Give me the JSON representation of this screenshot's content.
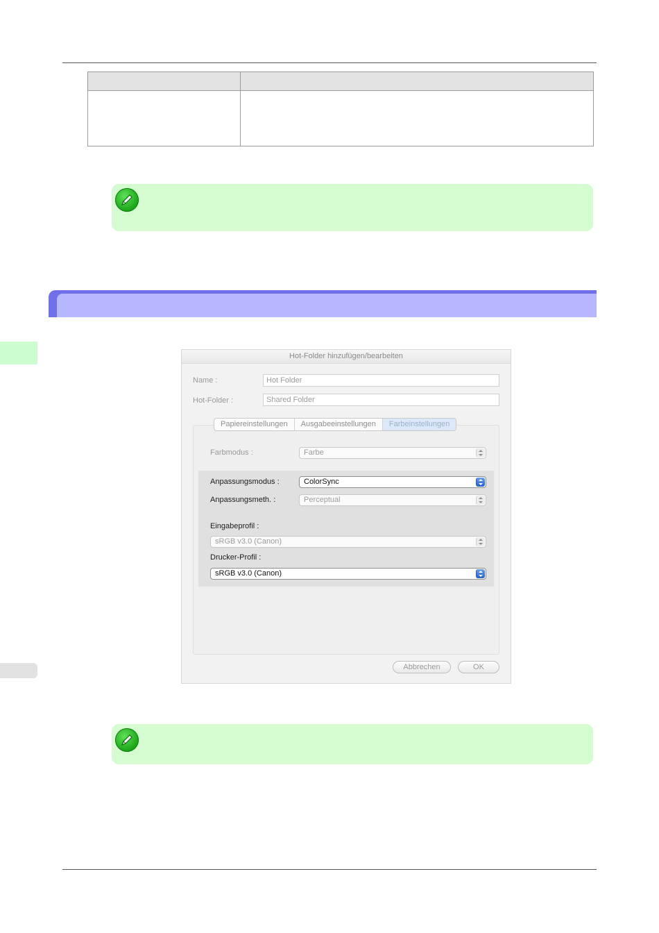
{
  "dialog": {
    "title": "Hot-Folder hinzufügen/bearbeiten",
    "name_label": "Name :",
    "name_value": "Hot Folder",
    "hotfolder_label": "Hot-Folder :",
    "hotfolder_value": "Shared Folder",
    "tabs": [
      {
        "label": "Papiereinstellungen",
        "active": false
      },
      {
        "label": "Ausgabeeinstellungen",
        "active": false
      },
      {
        "label": "Farbeinstellungen",
        "active": true
      }
    ],
    "farbmodus_label": "Farbmodus :",
    "farbmodus_value": "Farbe",
    "anpassungsmodus_label": "Anpassungsmodus :",
    "anpassungsmodus_value": "ColorSync",
    "anpassungsmeth_label": "Anpassungsmeth. :",
    "anpassungsmeth_value": "Perceptual",
    "eingabeprofil_label": "Eingabeprofil :",
    "eingabeprofil_value": "sRGB v3.0 (Canon)",
    "druckerprofil_label": "Drucker-Profil :",
    "druckerprofil_value": "sRGB v3.0 (Canon)",
    "cancel_label": "Abbrechen",
    "ok_label": "OK"
  },
  "colors": {
    "note_bg": "#d4fcd0",
    "band_outer": "#6f6fe9",
    "band_inner": "#b6b7ff",
    "side_tab": "#ccfcd0"
  }
}
